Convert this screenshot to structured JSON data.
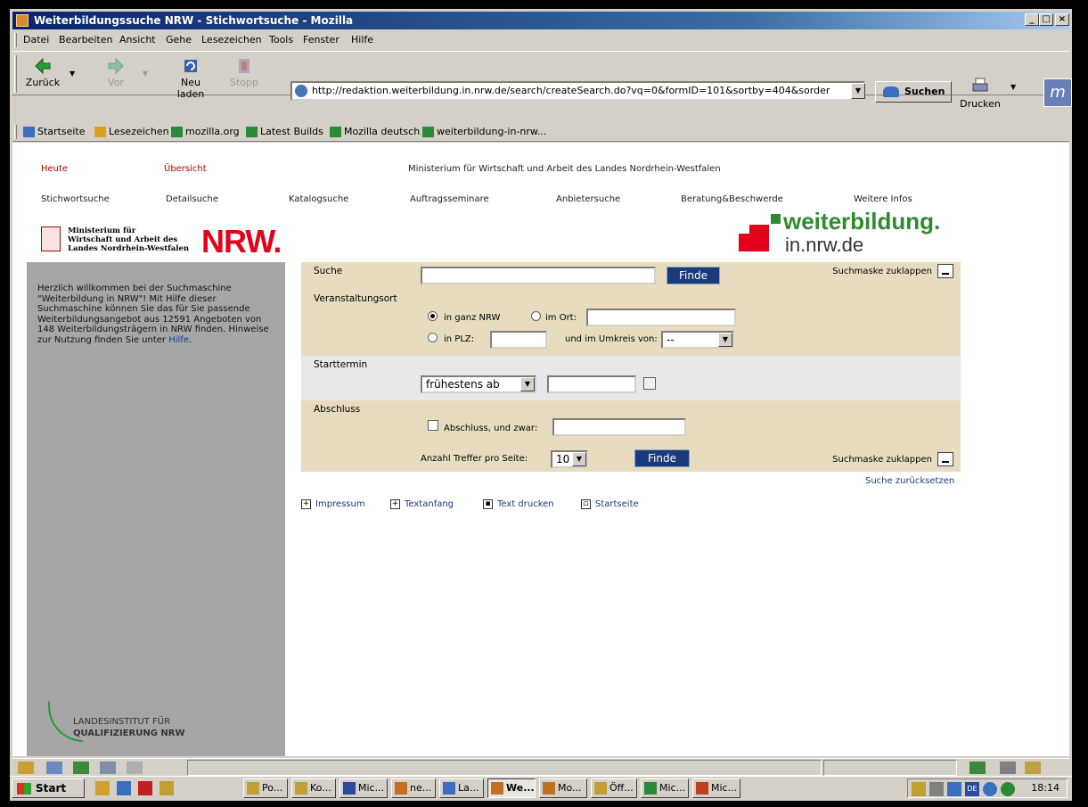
{
  "window": {
    "title": "Weiterbildungssuche NRW - Stichwortsuche - Mozilla"
  },
  "menubar": [
    "Datei",
    "Bearbeiten",
    "Ansicht",
    "Gehe",
    "Lesezeichen",
    "Tools",
    "Fenster",
    "Hilfe"
  ],
  "toolbar": {
    "back": "Zurück",
    "forward": "Vor",
    "reload": "Neu laden",
    "stop": "Stopp",
    "url": "http://redaktion.weiterbildung.in.nrw.de/search/createSearch.do?vq=0&formID=101&sortby=404&sorder",
    "search": "Suchen",
    "print": "Drucken"
  },
  "bookmarks": [
    "Startseite",
    "Lesezeichen",
    "mozilla.org",
    "Latest Builds",
    "Mozilla deutsch",
    "weiterbildung-in-nrw..."
  ],
  "page": {
    "top_links": {
      "heute": "Heute",
      "uebersicht": "Übersicht",
      "ministry_line": "Ministerium für Wirtschaft und Arbeit des Landes Nordrhein-Westfalen"
    },
    "nav": [
      "Stichwortsuche",
      "Detailsuche",
      "Katalogsuche",
      "Auftragsseminare",
      "Anbietersuche",
      "Beratung&Beschwerde",
      "Weitere Infos"
    ],
    "ministry_logo": {
      "text": "Ministerium für\nWirtschaft und Arbeit des\nLandes Nordrhein-Westfalen",
      "nrw": "NRW."
    },
    "wb_logo": {
      "line1": "weiterbildung.",
      "line2": "in.nrw.de"
    },
    "welcome": {
      "text": "Herzlich willkommen bei der Suchmaschine \"Weiterbildung in NRW\"! Mit Hilfe dieser Suchmaschine können Sie das für Sie passende Weiterbildungsangebot aus 12591 Angeboten von 148 Weiterbildungsträgern in NRW finden. Hinweise zur Nutzung finden Sie unter ",
      "help": "Hilfe",
      "end": "."
    },
    "lfq": {
      "line1": "LANDESINSTITUT FÜR",
      "line2": "QUALIFIZIERUNG NRW"
    },
    "form": {
      "suche_label": "Suche",
      "suche_value": "",
      "finde": "Finde",
      "collapse": "Suchmaske zuklappen",
      "ort_label": "Veranstaltungsort",
      "radio_nrw": "in ganz NRW",
      "radio_ort": "im Ort:",
      "radio_plz": "in PLZ:",
      "umkreis": "und im Umkreis von:",
      "umkreis_value": "--",
      "start_label": "Starttermin",
      "start_select": "frühestens ab",
      "abschluss_label": "Abschluss",
      "abschluss_check": "Abschluss, und zwar:",
      "treffer_label": "Anzahl Treffer pro Seite:",
      "treffer_value": "10"
    },
    "reset": "Suche zurücksetzen",
    "footer_links": [
      "Impressum",
      "Textanfang",
      "Text drucken",
      "Startseite"
    ]
  },
  "taskbar": {
    "start": "Start",
    "tasks": [
      "Po...",
      "Ko...",
      "Mic...",
      "ne...",
      "La...",
      "We...",
      "Mo...",
      "Öff...",
      "Mic...",
      "Mic..."
    ],
    "clock": "18:14",
    "lang": "DE"
  }
}
